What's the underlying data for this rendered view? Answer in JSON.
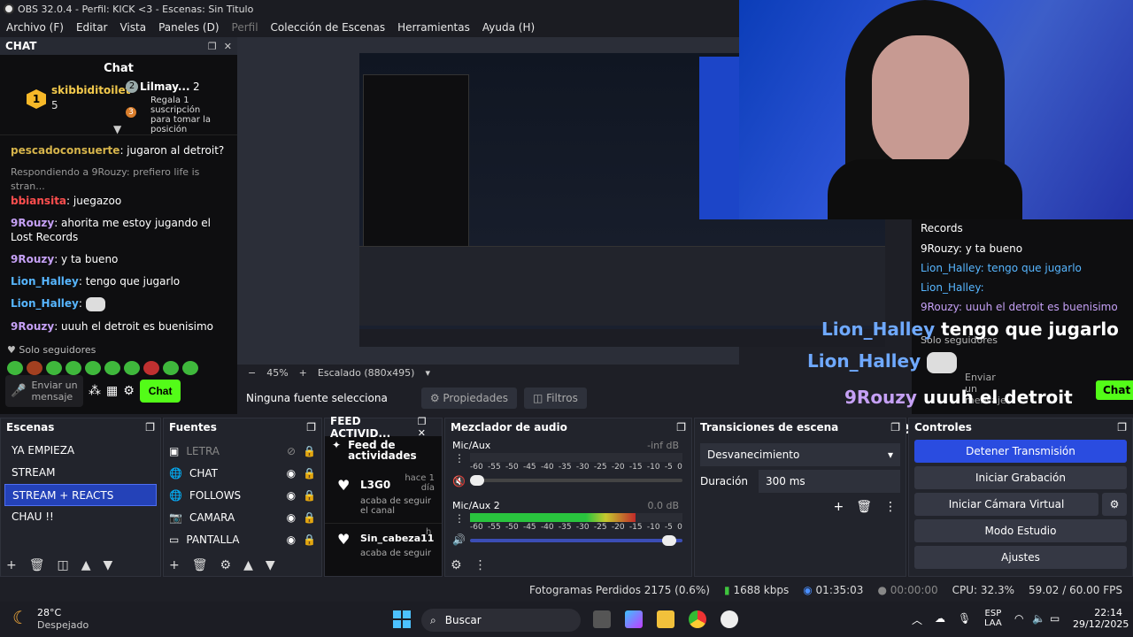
{
  "window": {
    "title": "OBS 32.0.4 - Perfil: KICK <3 - Escenas: Sin Titulo"
  },
  "menu": [
    "Archivo (F)",
    "Editar",
    "Vista",
    "Paneles (D)",
    "Perfil",
    "Colección de Escenas",
    "Herramientas",
    "Ayuda (H)"
  ],
  "chat": {
    "dock_title": "CHAT",
    "header": "Chat",
    "pinned": {
      "user1": "skibbiditoilet",
      "user1_badge": "1",
      "user1_count": "5",
      "user2": "Lilmay...",
      "user2_badge": "2",
      "user2_count": "2",
      "gift_text": "Regala 1 suscripción para tomar la posición",
      "gift_rank": "3"
    },
    "messages": [
      {
        "badge": "1",
        "user": "pescadoconsuerte",
        "text": ": jugaron al detroit?",
        "style": "gold"
      },
      {
        "reply": "Respondiendo a 9Rouzy: prefiero life is stran...",
        "user": "bbiansita",
        "text": ": juegazoo",
        "style": "red"
      },
      {
        "user": "9Rouzy",
        "text": ": ahorita me estoy jugando el Lost Records",
        "style": "purple"
      },
      {
        "user": "9Rouzy",
        "text": ": y ta bueno",
        "style": "purple"
      },
      {
        "user": "Lion_Halley",
        "text": ": tengo que jugarlo",
        "style": "blue"
      },
      {
        "user": "Lion_Halley",
        "text": ":",
        "style": "blue"
      },
      {
        "user": "9Rouzy",
        "text": ": uuuh el detroit es buenisimo",
        "style": "purple"
      }
    ],
    "followers_only": "Solo seguidores",
    "input_placeholder": "Enviar un mensaje",
    "send_label": "Chat"
  },
  "preview": {
    "zoom": "45%",
    "scaled": "Escalado (880x495)",
    "no_source": "Ninguna fuente selecciona",
    "properties": "Propiedades",
    "filters": "Filtros"
  },
  "overlay": {
    "lines": [
      {
        "user": "Lion_Halley",
        "text": "tengo que jugarlo"
      },
      {
        "user": "Lion_Halley",
        "text": ""
      },
      {
        "user": "9Rouzy",
        "text": "uuuh el detroit es buenisimo"
      }
    ],
    "rchat_records": "Records",
    "rchat_lines": [
      "9Rouzy: y ta bueno",
      "Lion_Halley: tengo que jugarlo",
      "Lion_Halley:",
      "9Rouzy: uuuh el detroit es buenisimo"
    ],
    "followers": "Solo seguidores",
    "input": "Enviar un mensaje",
    "send": "Chat"
  },
  "scenes": {
    "title": "Escenas",
    "items": [
      "YA EMPIEZA",
      "STREAM",
      "STREAM + REACTS",
      "CHAU !!"
    ],
    "selected": 2
  },
  "sources": {
    "title": "Fuentes",
    "items": [
      {
        "name": "LETRA",
        "icon": "text-icon",
        "hidden": true
      },
      {
        "name": "CHAT",
        "icon": "browser-icon",
        "hidden": false
      },
      {
        "name": "FOLLOWS",
        "icon": "browser-icon",
        "hidden": false
      },
      {
        "name": "CAMARA",
        "icon": "camera-icon",
        "hidden": false
      },
      {
        "name": "PANTALLA",
        "icon": "display-icon",
        "hidden": false
      }
    ]
  },
  "feed": {
    "title": "FEED ACTIVID...",
    "header": "Feed de actividades",
    "items": [
      {
        "user": "L3G0",
        "time": "hace 1 día",
        "text": "acaba de seguir el canal"
      },
      {
        "user": "Sin_cabeza11",
        "time": "h",
        "text": "acaba de seguir"
      }
    ]
  },
  "mixer": {
    "title": "Mezclador de audio",
    "scale": [
      "-60",
      "-55",
      "-50",
      "-45",
      "-40",
      "-35",
      "-30",
      "-25",
      "-20",
      "-15",
      "-10",
      "-5",
      "0"
    ],
    "channels": [
      {
        "name": "Mic/Aux",
        "db": "-inf dB",
        "level": 0.0,
        "volume": 0.02,
        "muted": true
      },
      {
        "name": "Mic/Aux 2",
        "db": "0.0 dB",
        "level": 0.78,
        "volume": 0.97,
        "muted": false
      }
    ]
  },
  "transitions": {
    "title": "Transiciones de escena",
    "selected": "Desvanecimiento",
    "duration_label": "Duración",
    "duration_value": "300 ms"
  },
  "controls": {
    "title": "Controles",
    "buttons": [
      "Detener Transmisión",
      "Iniciar Grabación",
      "Iniciar Cámara Virtual",
      "Modo Estudio",
      "Ajustes"
    ]
  },
  "status": {
    "dropped": "Fotogramas Perdidos 2175 (0.6%)",
    "kbps": "1688 kbps",
    "live_time": "01:35:03",
    "rec_time": "00:00:00",
    "cpu": "CPU: 32.3%",
    "fps": "59.02 / 60.00 FPS"
  },
  "taskbar": {
    "weather_temp": "28°C",
    "weather_desc": "Despejado",
    "search": "Buscar",
    "lang": "ESP",
    "lang2": "LAA",
    "time": "22:14",
    "date": "29/12/2025"
  }
}
